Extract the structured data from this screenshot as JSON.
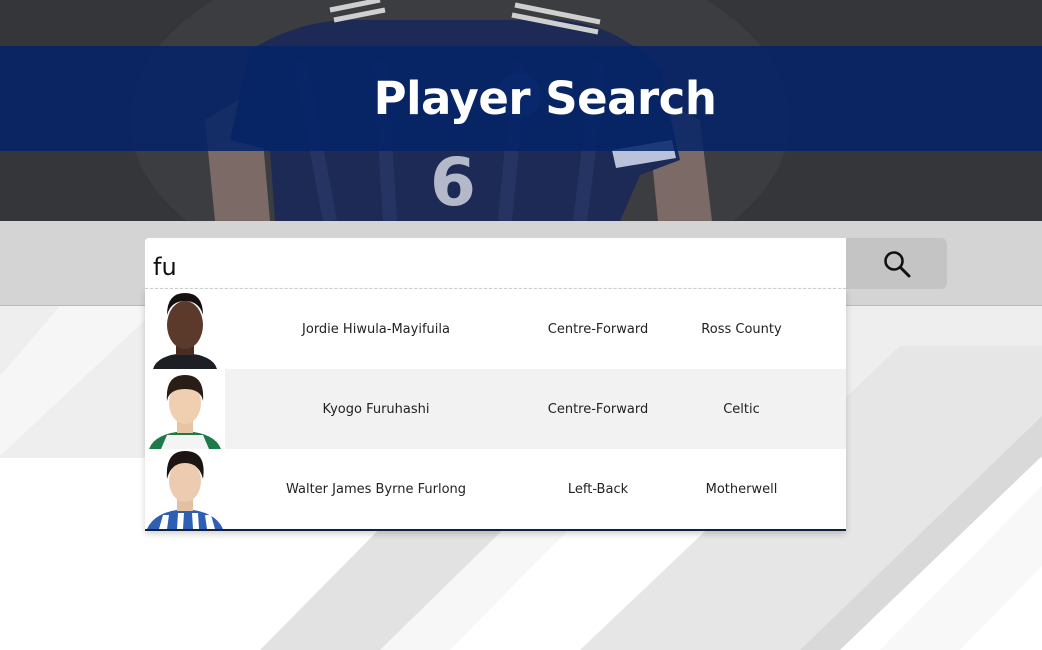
{
  "header": {
    "title": "Player Search",
    "band_color": "#042368",
    "shirt_number": "6"
  },
  "search": {
    "value": "fu",
    "button_icon": "search-icon"
  },
  "results": [
    {
      "name": "Jordie Hiwula-Mayifuila",
      "position": "Centre-Forward",
      "club": "Ross County",
      "avatar": "player-photo-icon"
    },
    {
      "name": "Kyogo Furuhashi",
      "position": "Centre-Forward",
      "club": "Celtic",
      "avatar": "player-photo-icon"
    },
    {
      "name": "Walter James Byrne Furlong",
      "position": "Left-Back",
      "club": "Motherwell",
      "avatar": "player-photo-icon"
    }
  ]
}
